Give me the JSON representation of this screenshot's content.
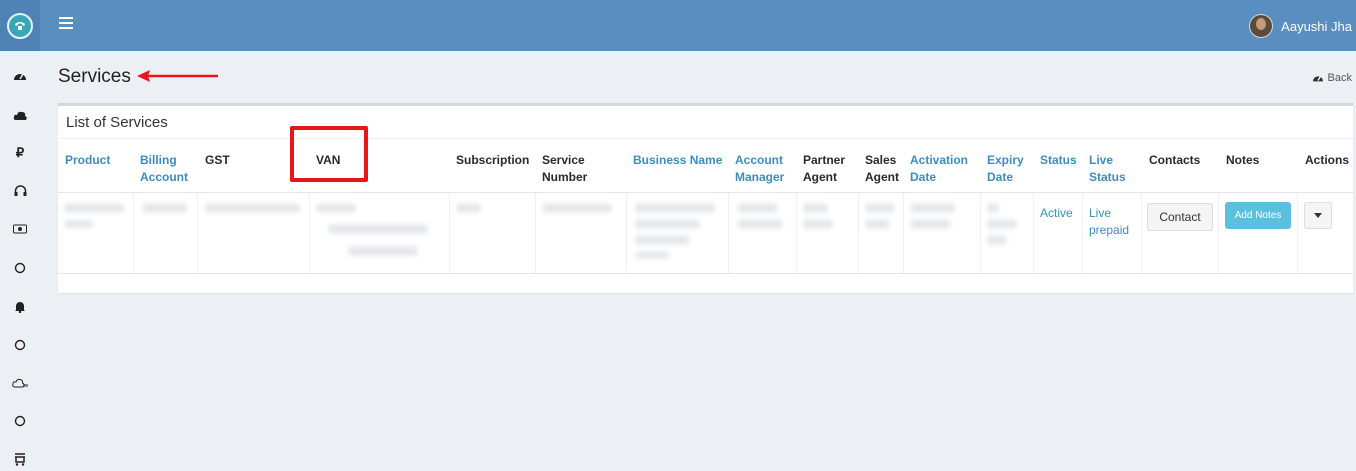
{
  "header": {
    "user_name": "Aayushi Jha"
  },
  "sidebar": {
    "icons": [
      "dashboard-icon",
      "cloud-icon",
      "rupee-icon",
      "headset-icon",
      "camera-icon",
      "circle-icon",
      "bell-icon",
      "circle-icon",
      "cloud-plug-icon",
      "circle-icon",
      "cart-icon"
    ]
  },
  "page": {
    "title": "Services",
    "back_label": "Back"
  },
  "panel": {
    "title": "List of Services"
  },
  "table": {
    "columns": [
      {
        "label": "Product",
        "link": true
      },
      {
        "label": "Billing Account",
        "link": true
      },
      {
        "label": "GST",
        "link": false
      },
      {
        "label": "VAN",
        "link": false
      },
      {
        "label": "Subscription",
        "link": false
      },
      {
        "label": "Service Number",
        "link": false
      },
      {
        "label": "Business Name",
        "link": true
      },
      {
        "label": "Account Manager",
        "link": true
      },
      {
        "label": "Partner Agent",
        "link": false
      },
      {
        "label": "Sales Agent",
        "link": false
      },
      {
        "label": "Activation Date",
        "link": true
      },
      {
        "label": "Expiry Date",
        "link": true
      },
      {
        "label": "Status",
        "link": true
      },
      {
        "label": "Live Status",
        "link": true
      },
      {
        "label": "Contacts",
        "link": false
      },
      {
        "label": "Notes",
        "link": false
      },
      {
        "label": "Actions",
        "link": false
      }
    ],
    "row": {
      "status": "Active",
      "live_status": "Live prepaid",
      "contact_button": "Contact",
      "notes_button": "Add Notes"
    }
  },
  "colors": {
    "topbar": "#5a8ec0",
    "link": "#3c8dbc",
    "info_button": "#5bc0de",
    "highlight": "#e8151b"
  }
}
